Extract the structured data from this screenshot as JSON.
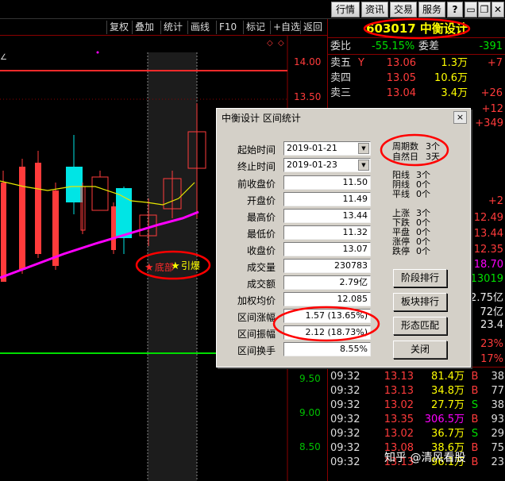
{
  "topbar": {
    "market": "行情",
    "news": "资讯",
    "trade": "交易",
    "service": "服务",
    "help": "?",
    "minimize": "▭",
    "restore": "❐",
    "close": "✕"
  },
  "toolbar": {
    "items": [
      "复权",
      "叠加",
      "统计",
      "画线",
      "F10",
      "标记",
      "+自选",
      "返回"
    ]
  },
  "chart_labels": {
    "bottom_label": "底部",
    "breakout_label": "引爆",
    "price_ticks": [
      "14.00",
      "13.50",
      "9.50",
      "9.00",
      "8.50"
    ]
  },
  "stock": {
    "code": "603017",
    "name": "中衡设计"
  },
  "ratio": {
    "label_wb": "委比",
    "wb_value": "-55.15%",
    "label_wc": "委差",
    "wc_value": "-391"
  },
  "asks": [
    {
      "label": "卖五",
      "sym": "Y",
      "price": "13.06",
      "vol": "1.3万",
      "chg": "+7"
    },
    {
      "label": "卖四",
      "sym": "",
      "price": "13.05",
      "vol": "10.6万",
      "chg": ""
    },
    {
      "label": "卖三",
      "sym": "",
      "price": "13.04",
      "vol": "3.4万",
      "chg": "+26"
    }
  ],
  "side_values": [
    {
      "text": "+12",
      "color": "red"
    },
    {
      "text": "+349",
      "color": "red"
    },
    {
      "text": "+2",
      "color": "red"
    },
    {
      "text": "12.49",
      "color": "red"
    },
    {
      "text": "13.44",
      "color": "red"
    },
    {
      "text": "12.35",
      "color": "red"
    },
    {
      "text": "18.70",
      "color": "magenta"
    },
    {
      "text": "13019",
      "color": "green"
    },
    {
      "text": "2.75亿",
      "color": "white"
    },
    {
      "text": "72亿",
      "color": "white"
    },
    {
      "text": "23.4",
      "color": "white"
    },
    {
      "text": "23%",
      "color": "red"
    },
    {
      "text": "17%",
      "color": "red"
    }
  ],
  "ticks": [
    {
      "time": "09:32",
      "price": "13.13",
      "vol": "81.4万",
      "bs": "B",
      "n": "38"
    },
    {
      "time": "09:32",
      "price": "13.13",
      "vol": "34.8万",
      "bs": "B",
      "n": "77"
    },
    {
      "time": "09:32",
      "price": "13.02",
      "vol": "27.7万",
      "bs": "S",
      "n": "38"
    },
    {
      "time": "09:32",
      "price": "13.35",
      "vol": "306.5万",
      "bs": "B",
      "n": "93"
    },
    {
      "time": "09:32",
      "price": "13.02",
      "vol": "36.7万",
      "bs": "S",
      "n": "29"
    },
    {
      "time": "09:32",
      "price": "13.08",
      "vol": "38.6万",
      "bs": "B",
      "n": "75"
    },
    {
      "time": "09:32",
      "price": "13.13",
      "vol": "96.1万",
      "bs": "B",
      "n": "23"
    }
  ],
  "dialog": {
    "title": "中衡设计 区间统计",
    "close": "×",
    "start_label": "起始时间",
    "start_value": "2019-01-21",
    "end_label": "终止时间",
    "end_value": "2019-01-23",
    "fields": [
      {
        "label": "前收盘价",
        "value": "11.50"
      },
      {
        "label": "开盘价",
        "value": "11.49"
      },
      {
        "label": "最高价",
        "value": "13.44"
      },
      {
        "label": "最低价",
        "value": "11.32"
      },
      {
        "label": "收盘价",
        "value": "13.07"
      },
      {
        "label": "成交量",
        "value": "230783"
      },
      {
        "label": "成交额",
        "value": "2.79亿"
      },
      {
        "label": "加权均价",
        "value": "12.085"
      },
      {
        "label": "区间涨幅",
        "value": "1.57 (13.65%)"
      },
      {
        "label": "区间振幅",
        "value": "2.12 (18.73%)"
      },
      {
        "label": "区间换手",
        "value": "8.55%"
      }
    ],
    "period_label": "周期数",
    "period_value": "3个",
    "natural_label": "自然日",
    "natural_value": "3天",
    "line_stats": [
      {
        "label": "阳线",
        "value": "3个"
      },
      {
        "label": "阴线",
        "value": "0个"
      },
      {
        "label": "平线",
        "value": "0个"
      }
    ],
    "move_stats": [
      {
        "label": "上涨",
        "value": "3个"
      },
      {
        "label": "下跌",
        "value": "0个"
      },
      {
        "label": "平盘",
        "value": "0个"
      },
      {
        "label": "涨停",
        "value": "0个"
      },
      {
        "label": "跌停",
        "value": "0个"
      }
    ],
    "buttons": {
      "stage_rank": "阶段排行",
      "sector_rank": "板块排行",
      "pattern_match": "形态匹配",
      "close_btn": "关闭"
    }
  },
  "watermark": "知乎 @清风看股"
}
